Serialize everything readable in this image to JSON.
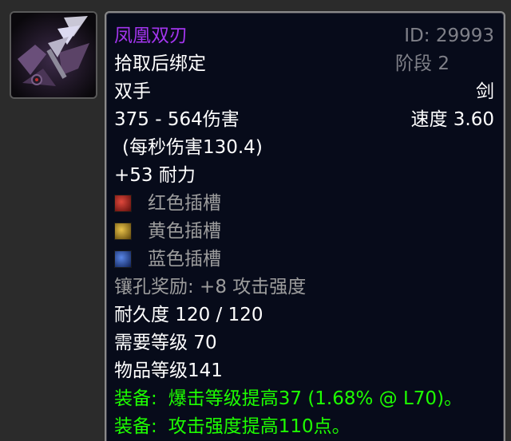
{
  "item": {
    "name": "凤凰双刃",
    "id_text": "ID: 29993",
    "binding": "拾取后绑定",
    "phase": "阶段 2",
    "slot": "双手",
    "weapon_type": "剑",
    "damage": "375 - 564伤害",
    "speed": "速度 3.60",
    "dps": "(每秒伤害130.4)",
    "stat_stamina": "+53 耐力",
    "sockets": [
      {
        "label": "红色插槽",
        "color": "#b3261e",
        "icon": "red-socket-icon"
      },
      {
        "label": "黄色插槽",
        "color": "#b08a1c",
        "icon": "yellow-socket-icon"
      },
      {
        "label": "蓝色插槽",
        "color": "#2a4fa8",
        "icon": "blue-socket-icon"
      }
    ],
    "socket_bonus": "镶孔奖励: +8 攻击强度",
    "durability": "耐久度 120 / 120",
    "required_level": "需要等级 70",
    "item_level": "物品等级141",
    "equip_effects": [
      {
        "prefix": "装备:",
        "text": "爆击等级提高37 (1.68% @ L70)。"
      },
      {
        "prefix": "装备:",
        "text": "攻击强度提高110点。"
      }
    ]
  },
  "colors": {
    "epic": "#a335ee",
    "equip_green": "#1eff00",
    "muted": "#7f8088",
    "tooltip_bg": "#070b1a"
  },
  "icon_name": "phoenix-blade-icon"
}
